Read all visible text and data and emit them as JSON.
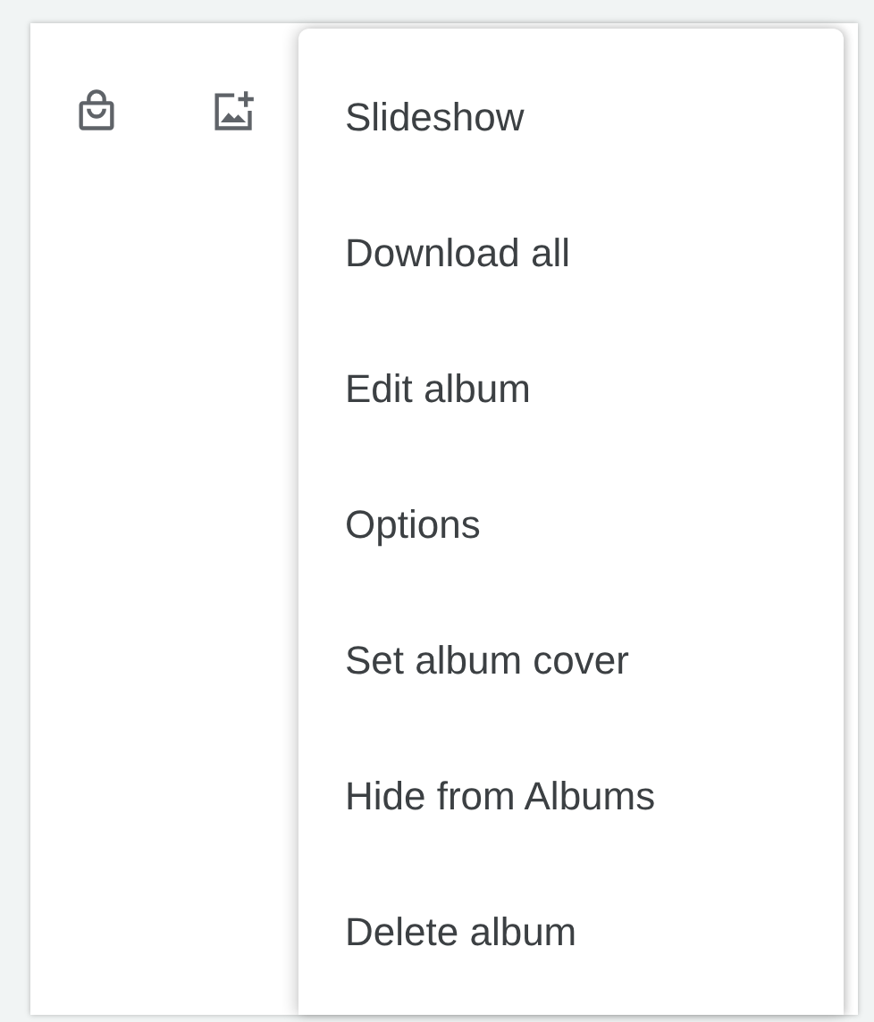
{
  "menu": {
    "items": [
      {
        "label": "Slideshow"
      },
      {
        "label": "Download all"
      },
      {
        "label": "Edit album"
      },
      {
        "label": "Options"
      },
      {
        "label": "Set album cover"
      },
      {
        "label": "Hide from Albums"
      },
      {
        "label": "Delete album"
      }
    ]
  }
}
